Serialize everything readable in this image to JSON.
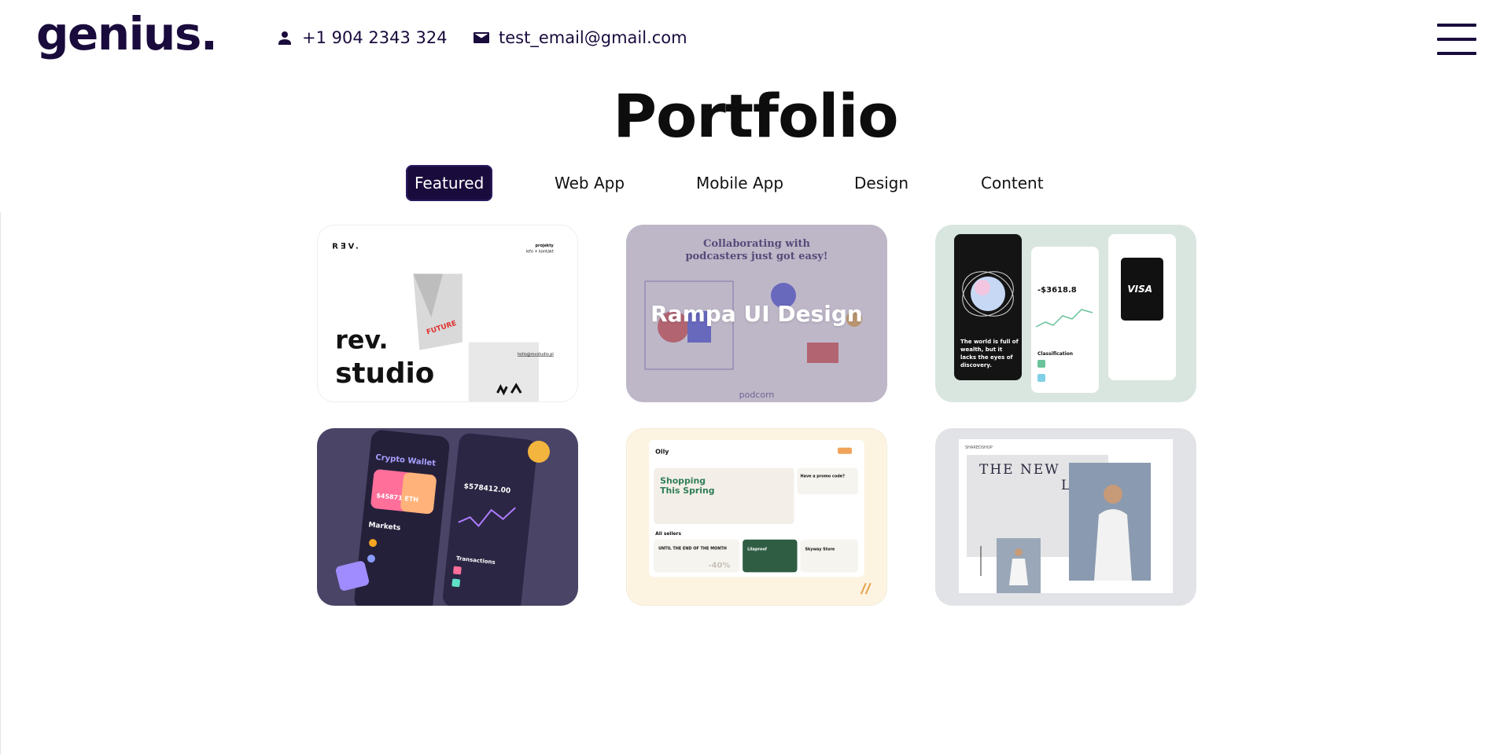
{
  "header": {
    "logo": "genius.",
    "phone": "+1 904 2343 324",
    "email": "test_email@gmail.com",
    "menu_icon": "hamburger-menu-icon"
  },
  "page": {
    "title": "Portfolio"
  },
  "tabs": [
    {
      "label": "Featured",
      "active": true
    },
    {
      "label": "Web App",
      "active": false
    },
    {
      "label": "Mobile App",
      "active": false
    },
    {
      "label": "Design",
      "active": false
    },
    {
      "label": "Content",
      "active": false
    }
  ],
  "portfolio": {
    "items": [
      {
        "brand": "R∃V.",
        "headline_1": "rev.",
        "headline_2": "studio",
        "nav": "projekty",
        "nav_sub": "lefo + kontakt",
        "email": "hello@revstudio.pl",
        "sticker": "FUTURE"
      },
      {
        "tagline_1": "Collaborating with",
        "tagline_2": "podcasters just got easy!",
        "hover_title": "Rampa UI Design",
        "footer": "podcorn"
      },
      {
        "caption_1": "The world is full of",
        "caption_2": "wealth, but it",
        "caption_3": "lacks the eyes of",
        "caption_4": "discovery.",
        "balance": "-$3618.8",
        "card_brand": "VISA",
        "section": "Classification"
      },
      {
        "card_title": "Crypto Wallet",
        "balance": "$45871 ETH",
        "section": "Markets",
        "amount": "$578412.00",
        "section_2": "Transactions"
      },
      {
        "brand": "Olly",
        "headline_1": "Shopping",
        "headline_2": "This Spring",
        "promo": "Have a promo code?",
        "list": "All sellers",
        "deal": "UNTIL THE END OF THE MONTH",
        "discount": "-40%",
        "store_1": "Lilaproof",
        "store_2": "Skyway Store"
      },
      {
        "brand": "SHAREDSHOP",
        "headline_1": "THE NEW",
        "headline_2": "LADY"
      }
    ]
  },
  "colors": {
    "brand_dark": "#1a0b3d",
    "hover_overlay": "#786ea0"
  }
}
